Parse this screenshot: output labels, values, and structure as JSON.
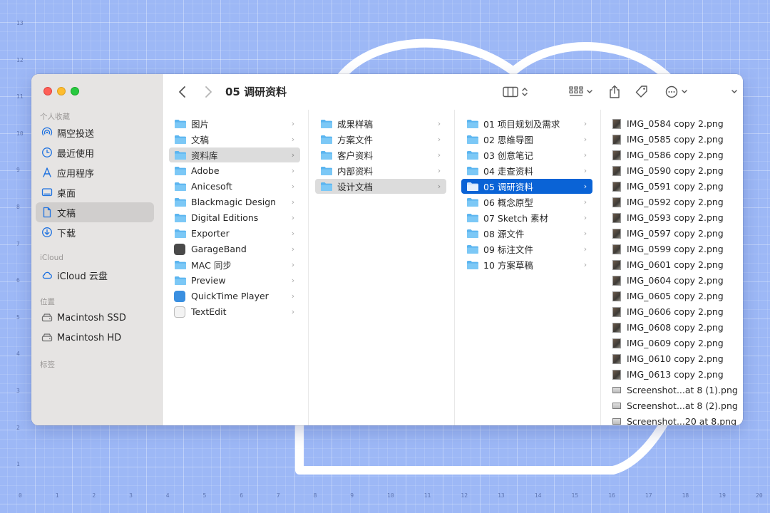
{
  "rulers": {
    "x": [
      "0",
      "1",
      "2",
      "3",
      "4",
      "5",
      "6",
      "7",
      "8",
      "9",
      "10",
      "11",
      "12",
      "13",
      "14",
      "15",
      "16",
      "17",
      "18",
      "19",
      "20"
    ],
    "y": [
      "13",
      "12",
      "11",
      "10",
      "9",
      "8",
      "7",
      "6",
      "5",
      "4",
      "3",
      "2",
      "1"
    ]
  },
  "window": {
    "title": "05 调研资料"
  },
  "sidebar": {
    "favorites_header": "个人收藏",
    "favorites": [
      {
        "label": "隔空投送",
        "icon": "airdrop-icon"
      },
      {
        "label": "最近使用",
        "icon": "clock-icon"
      },
      {
        "label": "应用程序",
        "icon": "apps-icon"
      },
      {
        "label": "桌面",
        "icon": "desktop-icon"
      },
      {
        "label": "文稿",
        "icon": "document-icon"
      },
      {
        "label": "下载",
        "icon": "download-icon"
      }
    ],
    "icloud_header": "iCloud",
    "icloud": [
      {
        "label": "iCloud 云盘",
        "icon": "cloud-icon"
      }
    ],
    "locations_header": "位置",
    "locations": [
      {
        "label": "Macintosh SSD",
        "icon": "drive-icon"
      },
      {
        "label": "Macintosh HD",
        "icon": "drive-icon"
      }
    ],
    "tags_header": "标签"
  },
  "columns": {
    "col1": [
      {
        "label": "图片",
        "kind": "folder"
      },
      {
        "label": "文稿",
        "kind": "folder"
      },
      {
        "label": "资料库",
        "kind": "folder"
      },
      {
        "label": "Adobe",
        "kind": "folder"
      },
      {
        "label": "Anicesoft",
        "kind": "folder"
      },
      {
        "label": "Blackmagic Design",
        "kind": "folder"
      },
      {
        "label": "Digital Editions",
        "kind": "folder"
      },
      {
        "label": "Exporter",
        "kind": "folder"
      },
      {
        "label": "GarageBand",
        "kind": "app"
      },
      {
        "label": "MAC 同步",
        "kind": "folder"
      },
      {
        "label": "Preview",
        "kind": "folder"
      },
      {
        "label": "QuickTime Player",
        "kind": "app"
      },
      {
        "label": "TextEdit",
        "kind": "app"
      }
    ],
    "col2": [
      {
        "label": "成果样稿",
        "kind": "folder"
      },
      {
        "label": "方案文件",
        "kind": "folder"
      },
      {
        "label": "客户资料",
        "kind": "folder"
      },
      {
        "label": "内部资料",
        "kind": "folder"
      },
      {
        "label": "设计文档",
        "kind": "folder"
      }
    ],
    "col3": [
      {
        "label": "01 项目规划及需求",
        "kind": "folder"
      },
      {
        "label": "02 思维导图",
        "kind": "folder"
      },
      {
        "label": "03 创意笔记",
        "kind": "folder"
      },
      {
        "label": "04 走查资料",
        "kind": "folder"
      },
      {
        "label": "05 调研资料",
        "kind": "folder"
      },
      {
        "label": "06 概念原型",
        "kind": "folder"
      },
      {
        "label": "07 Sketch 素材",
        "kind": "folder"
      },
      {
        "label": "08 源文件",
        "kind": "folder"
      },
      {
        "label": "09 标注文件",
        "kind": "folder"
      },
      {
        "label": "10 方案草稿",
        "kind": "folder"
      }
    ],
    "col4": [
      {
        "label": "IMG_0584 copy 2.png",
        "kind": "image"
      },
      {
        "label": "IMG_0585 copy 2.png",
        "kind": "image"
      },
      {
        "label": "IMG_0586 copy 2.png",
        "kind": "image"
      },
      {
        "label": "IMG_0590 copy 2.png",
        "kind": "image"
      },
      {
        "label": "IMG_0591 copy 2.png",
        "kind": "image"
      },
      {
        "label": "IMG_0592 copy 2.png",
        "kind": "image"
      },
      {
        "label": "IMG_0593 copy 2.png",
        "kind": "image"
      },
      {
        "label": "IMG_0597 copy 2.png",
        "kind": "image"
      },
      {
        "label": "IMG_0599 copy 2.png",
        "kind": "image"
      },
      {
        "label": "IMG_0601 copy 2.png",
        "kind": "image"
      },
      {
        "label": "IMG_0604 copy 2.png",
        "kind": "image"
      },
      {
        "label": "IMG_0605 copy 2.png",
        "kind": "image"
      },
      {
        "label": "IMG_0606 copy 2.png",
        "kind": "image"
      },
      {
        "label": "IMG_0608 copy 2.png",
        "kind": "image"
      },
      {
        "label": "IMG_0609 copy 2.png",
        "kind": "image"
      },
      {
        "label": "IMG_0610 copy 2.png",
        "kind": "image"
      },
      {
        "label": "IMG_0613 copy 2.png",
        "kind": "image"
      },
      {
        "label": "Screenshot...at 8 (1).png",
        "kind": "screenshot"
      },
      {
        "label": "Screenshot...at 8 (2).png",
        "kind": "screenshot"
      },
      {
        "label": "Screenshot...20 at 8.png",
        "kind": "screenshot"
      }
    ]
  },
  "selection": {
    "col1": 2,
    "col2": 4,
    "col3": 4
  },
  "colors": {
    "accent": "#0a63d6",
    "folder": "#5bb5f0",
    "background": "#9db8f6"
  }
}
